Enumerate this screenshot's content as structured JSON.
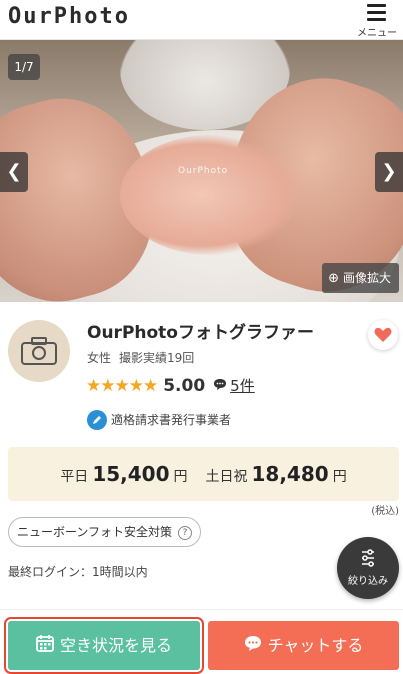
{
  "header": {
    "logo": "OurPhoto",
    "menu_label": "メニュー"
  },
  "gallery": {
    "counter": "1/7",
    "watermark": "OurPhoto",
    "zoom_label": "画像拡大"
  },
  "profile": {
    "name": "OurPhotoフォトグラファー",
    "gender": "女性",
    "shoot_record": "撮影実績19回",
    "stars": "★★★★★",
    "rating": "5.00",
    "review_count": "5件",
    "invoice_label": "適格請求書発行事業者"
  },
  "pricing": {
    "weekday_label": "平日",
    "weekday_price": "15,400",
    "weekday_unit": "円",
    "holiday_label": "土日祝",
    "holiday_price": "18,480",
    "holiday_unit": "円",
    "tax_note": "(税込)"
  },
  "safety_label": "ニューボーンフォト安全対策",
  "last_login": "最終ログイン：1時間以内",
  "filter_label": "絞り込み",
  "actions": {
    "availability_label": "空き状況を見る",
    "chat_label": "チャットする"
  },
  "colors": {
    "availability": "#5ac0a0",
    "chat": "#f46e55",
    "highlight": "#e8462f",
    "price_bg": "#f8f1e0",
    "star": "#f5a623"
  }
}
